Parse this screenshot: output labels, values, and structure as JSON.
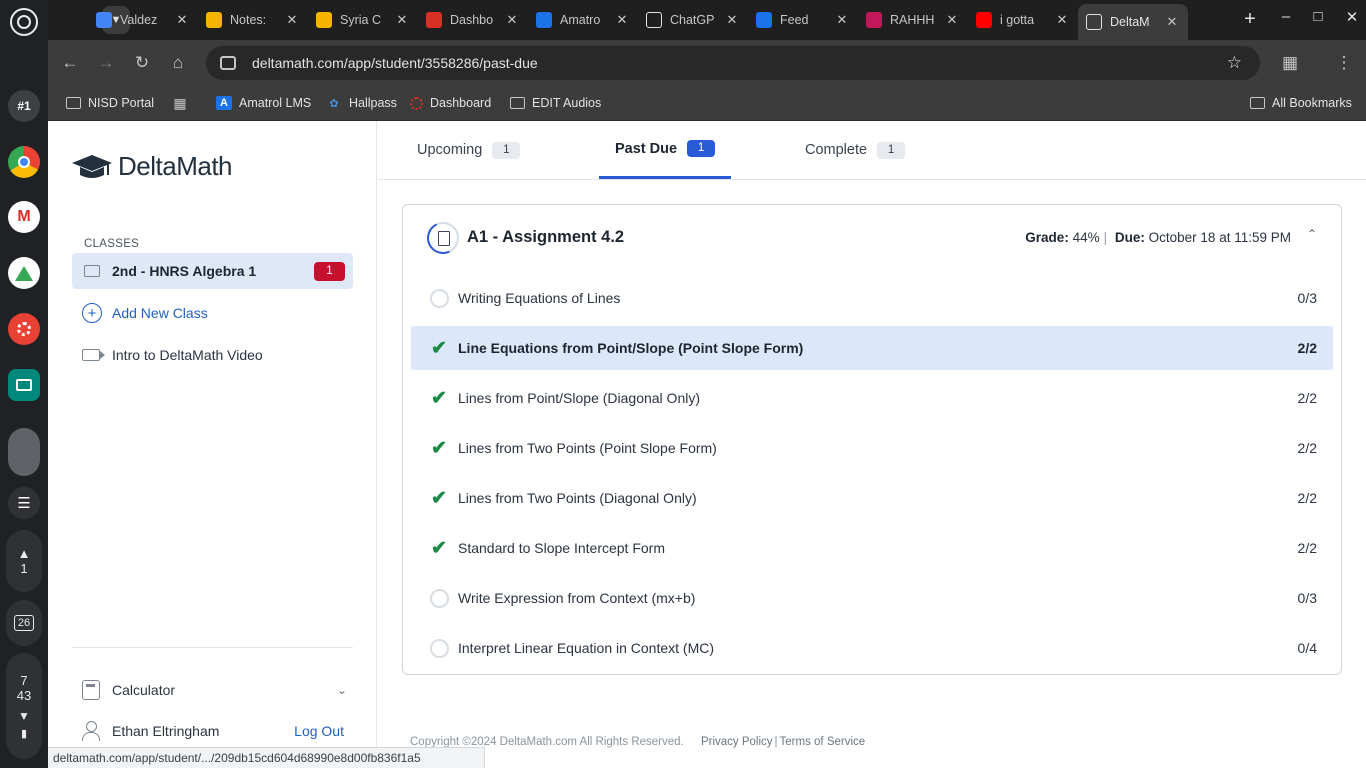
{
  "shelf": {
    "hash_label": "#1",
    "notification_count": "1",
    "calendar_day": "26",
    "time_hour": "7",
    "time_minute": "43"
  },
  "browser": {
    "tabs": [
      {
        "label": "Valdez",
        "icon": "docs-icon",
        "color": "#4285f4"
      },
      {
        "label": "Notes:",
        "icon": "slides-icon",
        "color": "#f4b400"
      },
      {
        "label": "Syria C",
        "icon": "slides-icon",
        "color": "#f4b400"
      },
      {
        "label": "Dashbo",
        "icon": "dashboard-icon",
        "color": "#d93025"
      },
      {
        "label": "Amatro",
        "icon": "amatrol-icon",
        "color": "#1a73e8"
      },
      {
        "label": "ChatGP",
        "icon": "openai-icon",
        "color": "#ffffff"
      },
      {
        "label": "Feed",
        "icon": "24-icon",
        "color": "#1a73e8"
      },
      {
        "label": "RAHHH",
        "icon": "w-icon",
        "color": "#c2185b"
      },
      {
        "label": "i gotta",
        "icon": "youtube-icon",
        "color": "#ff0000"
      },
      {
        "label": "DeltaM",
        "icon": "deltamath-icon",
        "color": "#ffffff"
      }
    ],
    "active_tab_index": 9,
    "url": "deltamath.com/app/student/3558286/past-due",
    "bookmarks": [
      {
        "label": "NISD Portal",
        "icon": "folder-icon"
      },
      {
        "label": "",
        "icon": "apps-grid-icon"
      },
      {
        "label": "Amatrol LMS",
        "icon": "amatrol-icon"
      },
      {
        "label": "Hallpass",
        "icon": "hallpass-icon"
      },
      {
        "label": "Dashboard",
        "icon": "dashboard-icon"
      },
      {
        "label": "EDIT Audios",
        "icon": "folder-icon"
      }
    ],
    "all_bookmarks_label": "All Bookmarks",
    "status_url": "deltamath.com/app/student/.../209db15cd604d68990e8d00fb836f1a5"
  },
  "sidebar": {
    "logo_text": "DeltaMath",
    "classes_label": "CLASSES",
    "class_name": "2nd - HNRS Algebra 1",
    "class_badge": "1",
    "add_class_label": "Add New Class",
    "intro_video_label": "Intro to DeltaMath Video",
    "calculator_label": "Calculator",
    "user_name": "Ethan Eltringham",
    "logout_label": "Log Out"
  },
  "main": {
    "tabs": [
      {
        "label": "Upcoming",
        "count": "1"
      },
      {
        "label": "Past Due",
        "count": "1"
      },
      {
        "label": "Complete",
        "count": "1"
      }
    ],
    "active_tab": "Past Due",
    "assignment": {
      "title": "A1 - Assignment 4.2",
      "grade_label": "Grade:",
      "grade_value": "44%",
      "due_label": "Due:",
      "due_value": "October 18 at 11:59 PM",
      "skills": [
        {
          "name": "Writing Equations of Lines",
          "score": "0/3",
          "complete": false
        },
        {
          "name": "Line Equations from Point/Slope (Point Slope Form)",
          "score": "2/2",
          "complete": true
        },
        {
          "name": "Lines from Point/Slope (Diagonal Only)",
          "score": "2/2",
          "complete": true
        },
        {
          "name": "Lines from Two Points (Point Slope Form)",
          "score": "2/2",
          "complete": true
        },
        {
          "name": "Lines from Two Points (Diagonal Only)",
          "score": "2/2",
          "complete": true
        },
        {
          "name": "Standard to Slope Intercept Form",
          "score": "2/2",
          "complete": true
        },
        {
          "name": "Write Expression from Context (mx+b)",
          "score": "0/3",
          "complete": false
        },
        {
          "name": "Interpret Linear Equation in Context (MC)",
          "score": "0/4",
          "complete": false
        }
      ],
      "highlighted_skill_index": 1
    },
    "footer": {
      "copyright": "Copyright ©2024 DeltaMath.com All Rights Reserved.",
      "privacy": "Privacy Policy",
      "terms": "Terms of Service"
    }
  },
  "colors": {
    "accent": "#2a5bd7",
    "badge_red": "#c8102e",
    "check_green": "#1a8a47",
    "highlight_row": "#dce8fa"
  }
}
